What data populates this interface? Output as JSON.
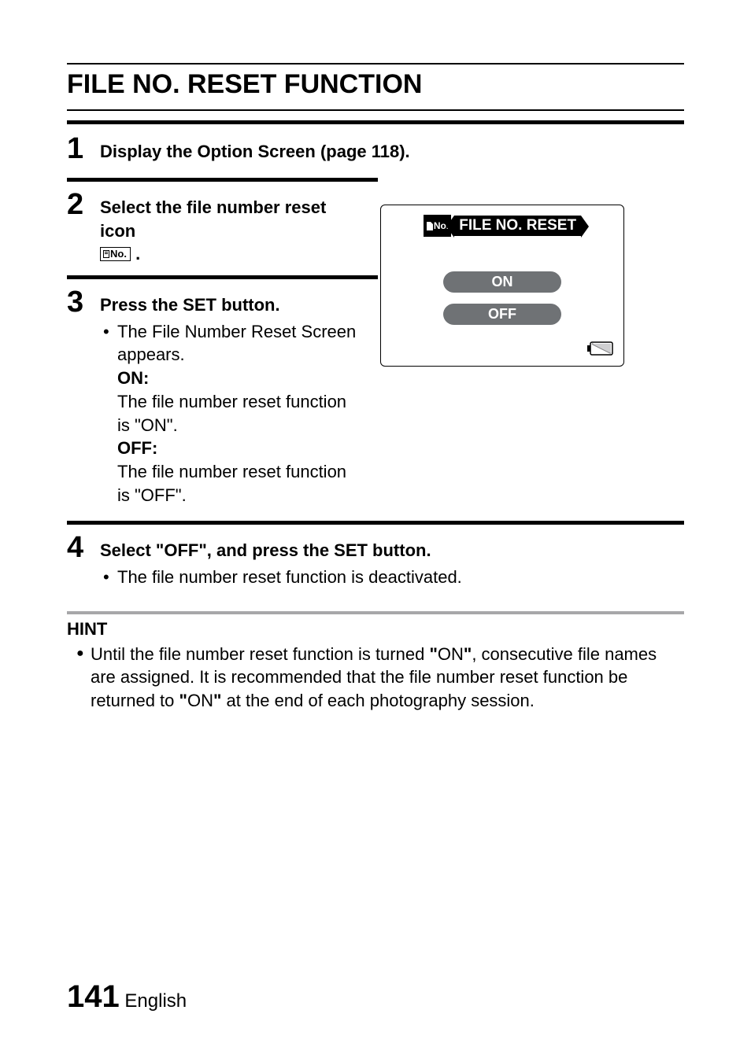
{
  "title": "FILE NO. RESET FUNCTION",
  "steps": {
    "s1": {
      "num": "1",
      "text": "Display the Option Screen (page 118)."
    },
    "s2": {
      "num": "2",
      "text_a": "Select the file number reset icon",
      "icon_label": "No.",
      "text_b": "."
    },
    "s3": {
      "num": "3",
      "heading": "Press the SET button.",
      "bullet": "The File Number Reset Screen appears.",
      "on_label": "ON:",
      "on_desc": "The file number reset function is \"ON\".",
      "off_label": "OFF:",
      "off_desc": "The file number reset function is \"OFF\"."
    },
    "s4": {
      "num": "4",
      "heading": "Select \"OFF\", and press the SET button.",
      "bullet": "The file number reset function is deactivated."
    }
  },
  "screen": {
    "icon_text": "No.",
    "title": "FILE NO. RESET",
    "on": "ON",
    "off": "OFF"
  },
  "hint": {
    "title": "HINT",
    "text_a": "Until the file number reset function is turned ",
    "quote_on1": "\"",
    "on_word": "ON",
    "quote_on2": "\"",
    "text_b": ", consecutive file names are assigned. It is recommended that the file number reset function be returned to ",
    "quote_on3": "\"",
    "on_word2": "ON",
    "quote_on4": "\"",
    "text_c": " at the end of each photography session."
  },
  "footer": {
    "page": "141",
    "lang": "English"
  }
}
